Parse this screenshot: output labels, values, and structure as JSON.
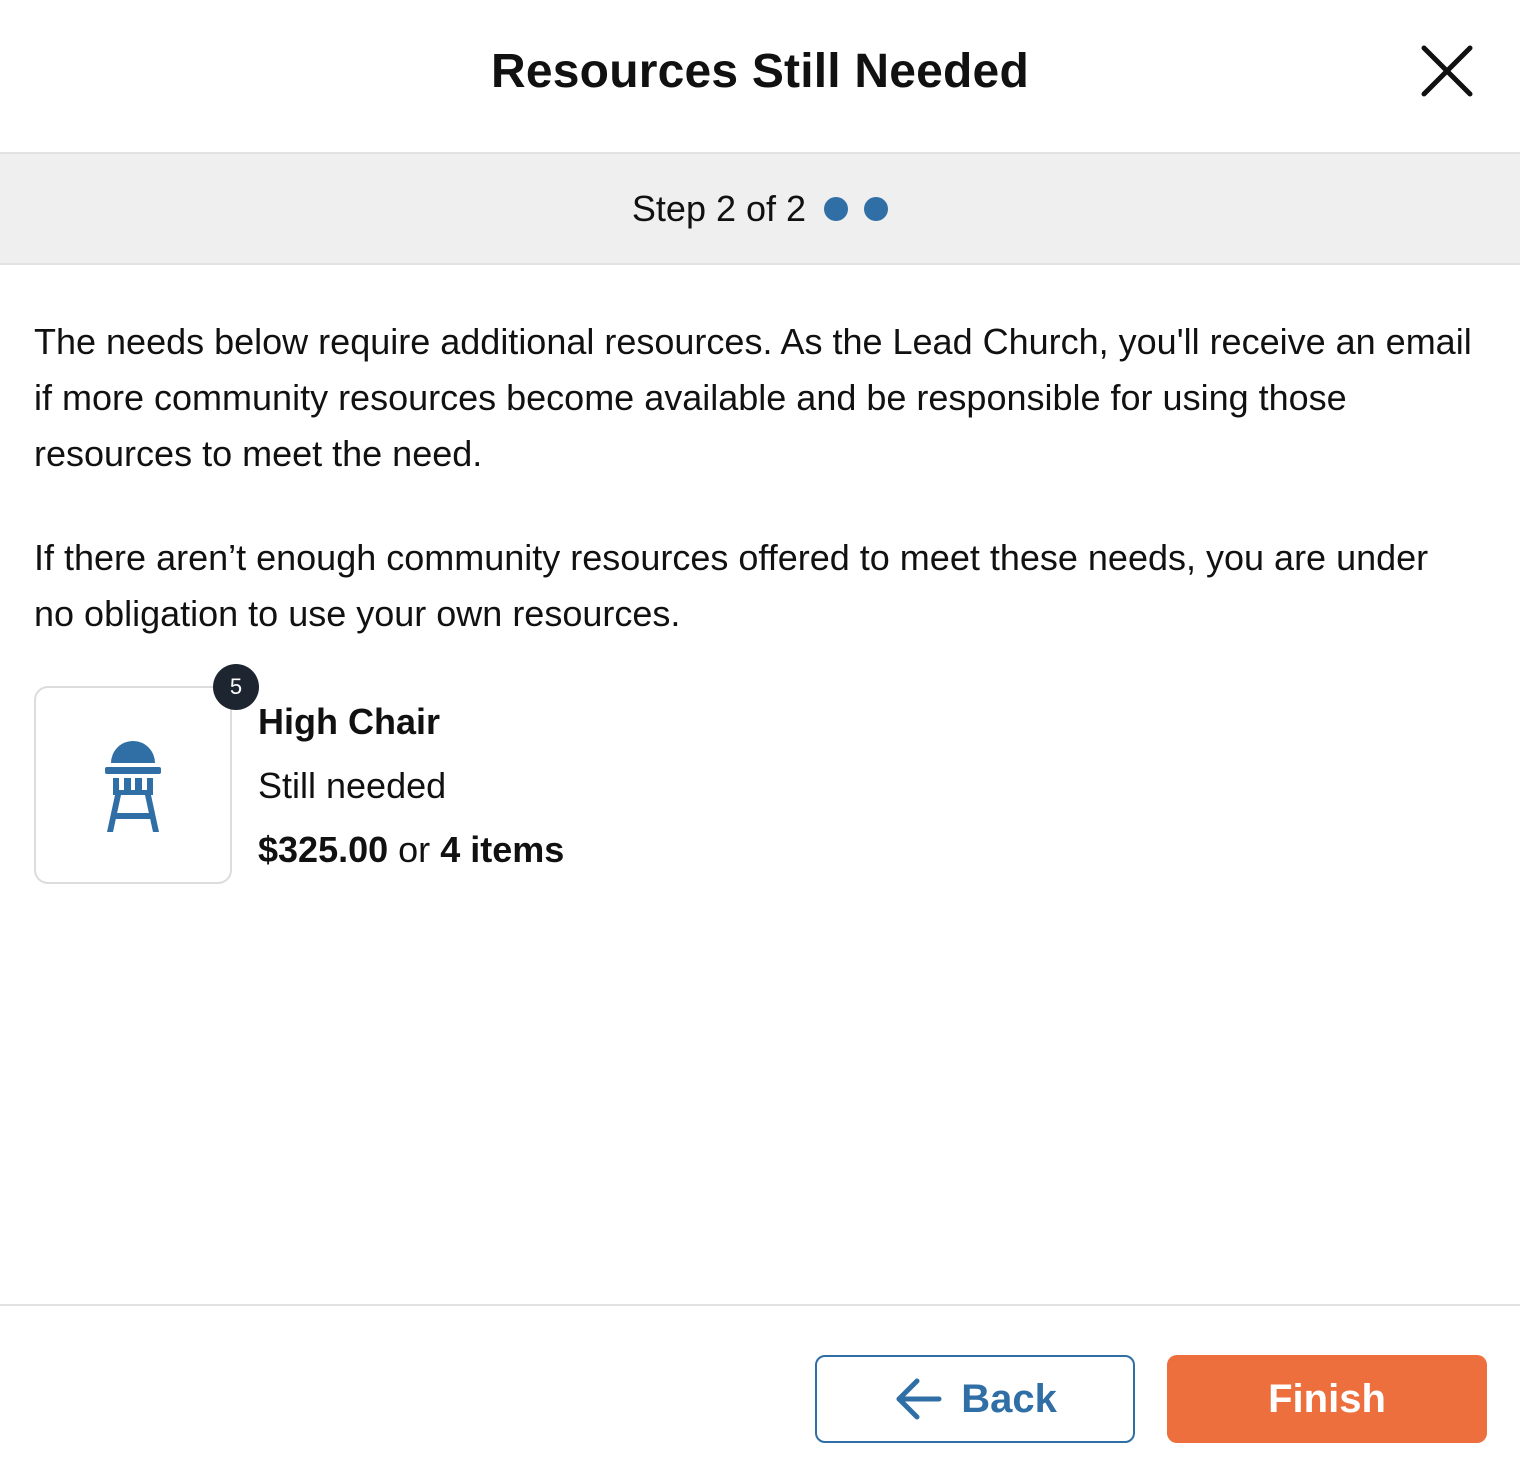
{
  "modal": {
    "title": "Resources Still Needed",
    "close_icon": "close-icon"
  },
  "step": {
    "label": "Step 2 of 2",
    "current": 2,
    "total": 2,
    "dot_color": "#2f6fa6"
  },
  "content": {
    "paragraph_1": "The needs below require additional resources. As the Lead Church, you'll receive an email if more community resources become available and be responsible for using those resources to meet the need.",
    "paragraph_2": "If there aren’t enough community resources offered to meet these needs, you are under no obligation to use your own resources."
  },
  "needs": [
    {
      "icon": "high-chair-icon",
      "badge": "5",
      "name": "High Chair",
      "status": "Still needed",
      "amount": "$325.00",
      "separator": "or",
      "items": "4 items"
    }
  ],
  "footer": {
    "back_label": "Back",
    "back_icon": "arrow-left-icon",
    "finish_label": "Finish"
  },
  "colors": {
    "accent_blue": "#2f6fa6",
    "finish_orange": "#ec6f3d",
    "badge_dark": "#1d2630",
    "stepbar_bg": "#efefef"
  }
}
